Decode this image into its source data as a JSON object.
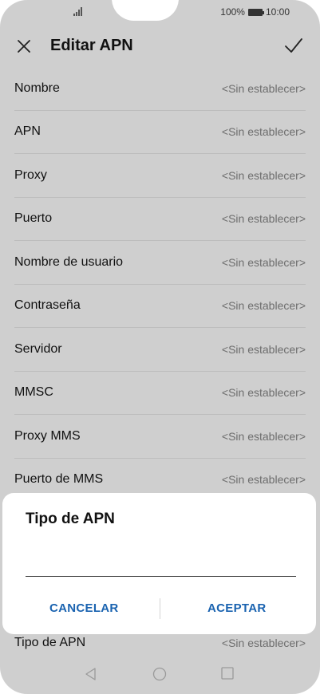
{
  "status_bar": {
    "battery_text": "100%",
    "time": "10:00"
  },
  "header": {
    "title": "Editar APN",
    "close_icon": "close-icon",
    "confirm_icon": "check-icon"
  },
  "apn_fields": [
    {
      "label": "Nombre",
      "value": "<Sin establecer>"
    },
    {
      "label": "APN",
      "value": "<Sin establecer>"
    },
    {
      "label": "Proxy",
      "value": "<Sin establecer>"
    },
    {
      "label": "Puerto",
      "value": "<Sin establecer>"
    },
    {
      "label": "Nombre de usuario",
      "value": "<Sin establecer>"
    },
    {
      "label": "Contraseña",
      "value": "<Sin establecer>"
    },
    {
      "label": "Servidor",
      "value": "<Sin establecer>"
    },
    {
      "label": "MMSC",
      "value": "<Sin establecer>"
    },
    {
      "label": "Proxy MMS",
      "value": "<Sin establecer>"
    },
    {
      "label": "Puerto de MMS",
      "value": "<Sin establecer>"
    }
  ],
  "bottom_field": {
    "label": "Tipo de APN",
    "value": "<Sin establecer>"
  },
  "dialog": {
    "title": "Tipo de APN",
    "input_value": "",
    "cancel_label": "CANCELAR",
    "accept_label": "ACEPTAR"
  },
  "colors": {
    "overlay_background": "#cfcfcf",
    "accent": "#1a63b0",
    "dialog_background": "#ffffff"
  }
}
